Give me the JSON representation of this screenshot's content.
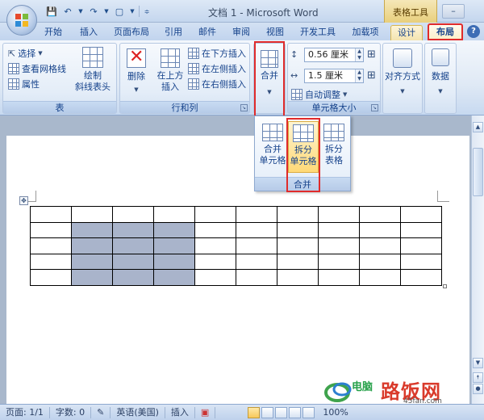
{
  "window": {
    "title": "文档 1 - Microsoft Word",
    "contextual_group": "表格工具",
    "help": "?"
  },
  "tabs": [
    {
      "label": "开始"
    },
    {
      "label": "插入"
    },
    {
      "label": "页面布局"
    },
    {
      "label": "引用"
    },
    {
      "label": "邮件"
    },
    {
      "label": "审阅"
    },
    {
      "label": "视图"
    },
    {
      "label": "开发工具"
    },
    {
      "label": "加载项"
    },
    {
      "label": "设计"
    },
    {
      "label": "布局",
      "active": true
    }
  ],
  "ribbon": {
    "table_group": {
      "label": "表",
      "select": "选择",
      "gridlines": "查看网格线",
      "properties": "属性",
      "draw_diagonal": "绘制\n斜线表头"
    },
    "rows_cols_group": {
      "label": "行和列",
      "delete": "删除",
      "insert_above": "在上方\n插入",
      "insert_below": "在下方插入",
      "insert_left": "在左侧插入",
      "insert_right": "在右侧插入"
    },
    "merge_group": {
      "merge": "合并"
    },
    "cell_size_group": {
      "label": "单元格大小",
      "height_value": "0.56 厘米",
      "width_value": "1.5 厘米",
      "autofit": "自动调整"
    },
    "alignment": "对齐方式",
    "data": "数据"
  },
  "merge_dropdown": {
    "items": [
      {
        "label": "合并\n单元格"
      },
      {
        "label": "拆分\n单元格",
        "highlighted": true
      },
      {
        "label": "拆分\n表格"
      }
    ],
    "footer": "合并"
  },
  "document_table": {
    "rows": 5,
    "cols": 10,
    "selected_rows": [
      1,
      2,
      3,
      4
    ],
    "selected_cols": [
      1,
      2,
      3
    ]
  },
  "statusbar": {
    "page": "页面: 1/1",
    "words": "字数: 0",
    "language": "英语(美国)",
    "mode": "插入",
    "zoom": "100%"
  },
  "watermark": {
    "brand": "路饭网",
    "url": "45fan.com",
    "left_text": "电脑"
  },
  "colors": {
    "highlight_box": "#e02b2b",
    "selected_cell": "#a9b4cb",
    "ribbon_text": "#15428b"
  }
}
